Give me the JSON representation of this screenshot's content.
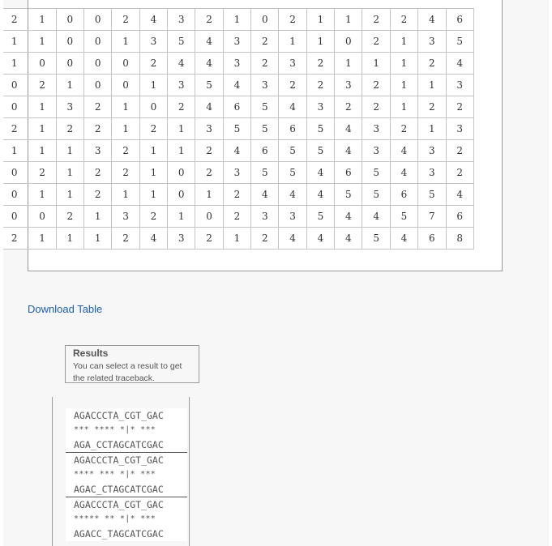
{
  "grid": {
    "rows": [
      [
        "2",
        "1",
        "0",
        "0",
        "2",
        "4",
        "3",
        "2",
        "1",
        "0",
        "2",
        "1",
        "1",
        "2",
        "2",
        "4",
        "6"
      ],
      [
        "1",
        "1",
        "0",
        "0",
        "1",
        "3",
        "5",
        "4",
        "3",
        "2",
        "1",
        "1",
        "0",
        "2",
        "1",
        "3",
        "5"
      ],
      [
        "1",
        "0",
        "0",
        "0",
        "0",
        "2",
        "4",
        "4",
        "3",
        "2",
        "3",
        "2",
        "1",
        "1",
        "1",
        "2",
        "4"
      ],
      [
        "0",
        "2",
        "1",
        "0",
        "0",
        "1",
        "3",
        "5",
        "4",
        "3",
        "2",
        "2",
        "3",
        "2",
        "1",
        "1",
        "3"
      ],
      [
        "0",
        "1",
        "3",
        "2",
        "1",
        "0",
        "2",
        "4",
        "6",
        "5",
        "4",
        "3",
        "2",
        "2",
        "1",
        "2",
        "2"
      ],
      [
        "2",
        "1",
        "2",
        "2",
        "1",
        "2",
        "1",
        "3",
        "5",
        "5",
        "6",
        "5",
        "4",
        "3",
        "2",
        "1",
        "3"
      ],
      [
        "1",
        "1",
        "1",
        "3",
        "2",
        "1",
        "1",
        "2",
        "4",
        "6",
        "5",
        "5",
        "4",
        "3",
        "4",
        "3",
        "2"
      ],
      [
        "0",
        "2",
        "1",
        "2",
        "2",
        "1",
        "0",
        "2",
        "3",
        "5",
        "5",
        "4",
        "6",
        "5",
        "4",
        "3",
        "2"
      ],
      [
        "0",
        "1",
        "1",
        "2",
        "1",
        "1",
        "0",
        "1",
        "2",
        "4",
        "4",
        "4",
        "5",
        "5",
        "6",
        "5",
        "4"
      ],
      [
        "0",
        "0",
        "2",
        "1",
        "3",
        "2",
        "1",
        "0",
        "2",
        "3",
        "3",
        "5",
        "4",
        "4",
        "5",
        "7",
        "6"
      ],
      [
        "2",
        "1",
        "1",
        "1",
        "2",
        "4",
        "3",
        "2",
        "1",
        "2",
        "4",
        "4",
        "4",
        "5",
        "4",
        "6",
        "8"
      ]
    ]
  },
  "download": {
    "label": "Download Table"
  },
  "results": {
    "title": "Results",
    "hint": "You can select a result to get the related traceback."
  },
  "tracebacks": [
    {
      "top": "AGACCCTA_CGT_GAC",
      "match": "*** **** *|* ***",
      "bottom": "AGA_CCTAGCATCGAC"
    },
    {
      "top": "AGACCCTA_CGT_GAC",
      "match": "**** *** *|* ***",
      "bottom": "AGAC_CTAGCATCGAC"
    },
    {
      "top": "AGACCCTA_CGT_GAC",
      "match": "***** ** *|* ***",
      "bottom": "AGACC_TAGCATCGAC"
    }
  ]
}
